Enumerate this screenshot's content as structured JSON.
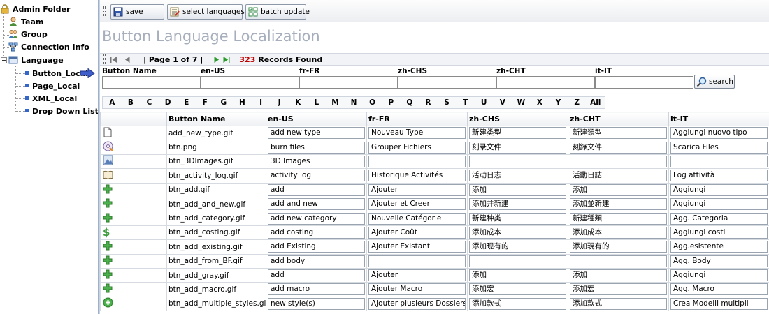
{
  "tree": {
    "root": "Admin Folder",
    "items": [
      "Team",
      "Group",
      "Connection Info",
      "Language"
    ],
    "language_children": [
      "Button_Local",
      "Page_Local",
      "XML_Local",
      "Drop Down List"
    ]
  },
  "toolbar": {
    "save": "save",
    "select_languages": "select languages...",
    "batch_update": "batch update"
  },
  "page_title": "Button Language Localization",
  "pager": {
    "page_text": "| Page 1 of 7 |",
    "count": "323",
    "found": "Records Found"
  },
  "filters": {
    "labels": [
      "Button Name",
      "en-US",
      "fr-FR",
      "zh-CHS",
      "zh-CHT",
      "it-IT"
    ],
    "search": "search"
  },
  "alphabet": [
    "A",
    "B",
    "C",
    "D",
    "E",
    "F",
    "G",
    "H",
    "I",
    "J",
    "K",
    "L",
    "M",
    "N",
    "O",
    "P",
    "Q",
    "R",
    "S",
    "T",
    "U",
    "V",
    "W",
    "X",
    "Y",
    "Z",
    "All"
  ],
  "grid": {
    "headers": [
      "",
      "Button Name",
      "en-US",
      "fr-FR",
      "zh-CHS",
      "zh-CHT",
      "it-IT"
    ],
    "rows": [
      {
        "icon": "new-doc-icon",
        "name": "add_new_type.gif",
        "en": "add new type",
        "fr": "Nouveau Type",
        "chs": "新建类型",
        "cht": "新建類型",
        "it": "Aggiungi nuovo tipo"
      },
      {
        "icon": "burn-disc-icon",
        "name": "btn.png",
        "en": "burn files",
        "fr": "Grouper Fichiers",
        "chs": "刻录文件",
        "cht": "刻錄文件",
        "it": "Scarica Files"
      },
      {
        "icon": "image-3d-icon",
        "name": "btn_3DImages.gif",
        "en": "3D Images",
        "fr": "",
        "chs": "",
        "cht": "",
        "it": ""
      },
      {
        "icon": "book-icon",
        "name": "btn_activity_log.gif",
        "en": "activity log",
        "fr": "Historique Activités",
        "chs": "活动日志",
        "cht": "活動日誌",
        "it": "Log attività"
      },
      {
        "icon": "plus-icon",
        "name": "btn_add.gif",
        "en": "add",
        "fr": "Ajouter",
        "chs": "添加",
        "cht": "添加",
        "it": "Aggiungi"
      },
      {
        "icon": "plus-icon",
        "name": "btn_add_and_new.gif",
        "en": "add and new",
        "fr": "Ajouter et Creer",
        "chs": "添加并新建",
        "cht": "添加並新建",
        "it": "Aggiungi"
      },
      {
        "icon": "plus-icon",
        "name": "btn_add_category.gif",
        "en": "add new category",
        "fr": "Nouvelle Catégorie",
        "chs": "新建种类",
        "cht": "新建種類",
        "it": "Agg. Categoria"
      },
      {
        "icon": "dollar-icon",
        "name": "btn_add_costing.gif",
        "en": "add costing",
        "fr": "Ajouter Coût",
        "chs": "添加成本",
        "cht": "添加成本",
        "it": "Aggiungi costi"
      },
      {
        "icon": "plus-icon",
        "name": "btn_add_existing.gif",
        "en": "add Existing",
        "fr": "Ajouter Existant",
        "chs": "添加现有的",
        "cht": "添加現有的",
        "it": "Agg.esistente"
      },
      {
        "icon": "plus-icon",
        "name": "btn_add_from_BF.gif",
        "en": "add body",
        "fr": "",
        "chs": "",
        "cht": "",
        "it": "Agg. Body"
      },
      {
        "icon": "plus-icon",
        "name": "btn_add_gray.gif",
        "en": "add",
        "fr": "Ajouter",
        "chs": "添加",
        "cht": "添加",
        "it": "Aggiungi"
      },
      {
        "icon": "plus-icon",
        "name": "btn_add_macro.gif",
        "en": "add macro",
        "fr": "Ajouter Macro",
        "chs": "添加宏",
        "cht": "添加宏",
        "it": "Agg. Macro"
      },
      {
        "icon": "green-circle-plus-icon",
        "name": "btn_add_multiple_styles.gif",
        "en": "new style(s)",
        "fr": "Ajouter plusieurs Dossiers",
        "chs": "添加款式",
        "cht": "添加款式",
        "it": "Crea Modelli multipli"
      }
    ]
  }
}
